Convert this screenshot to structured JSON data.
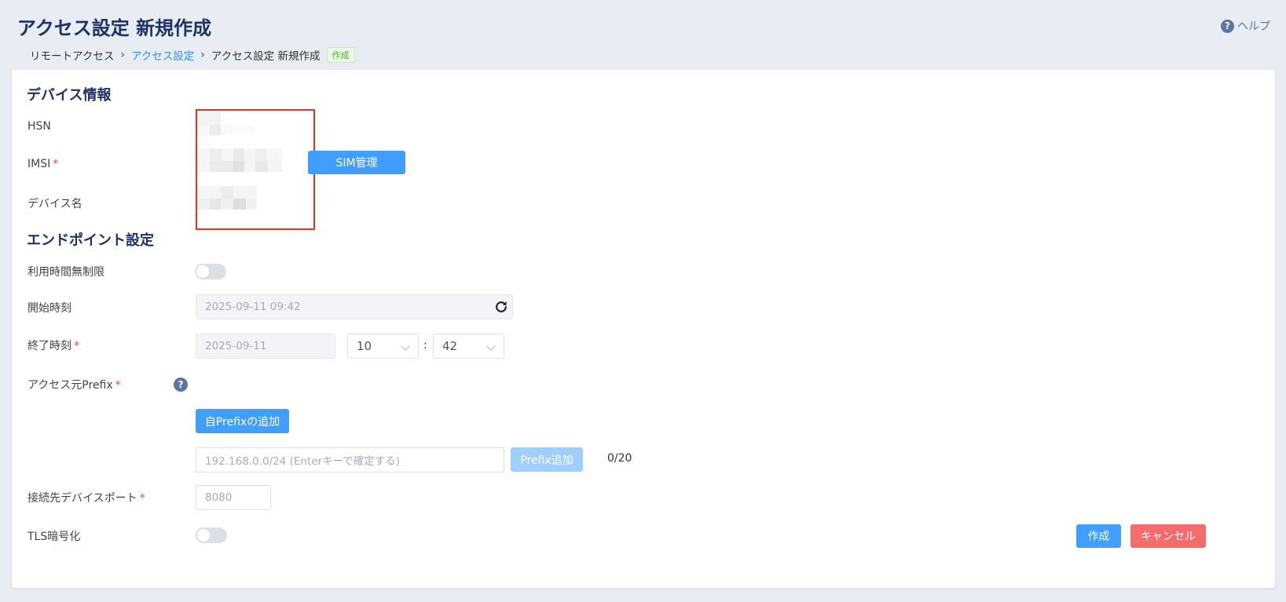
{
  "page": {
    "title": "アクセス設定 新規作成",
    "help_label": "ヘルプ"
  },
  "breadcrumb": {
    "items": [
      "リモートアクセス",
      "アクセス設定",
      "アクセス設定 新規作成"
    ],
    "badge": "作成"
  },
  "device_section": {
    "title": "デバイス情報",
    "hsn_label": "HSN",
    "imsi_label": "IMSI",
    "device_name_label": "デバイス名",
    "sim_button": "SIM管理"
  },
  "endpoint_section": {
    "title": "エンドポイント設定",
    "unlimited_label": "利用時間無制限",
    "start_label": "開始時刻",
    "start_value": "2025-09-11 09:42",
    "end_label": "終了時刻",
    "end_date": "2025-09-11",
    "end_hour": "10",
    "end_minute": "42",
    "time_sep": ":",
    "prefix_label": "アクセス元Prefix",
    "add_own_prefix_button": "自Prefixの追加",
    "prefix_placeholder": "192.168.0.0/24 (Enterキーで確定する)",
    "prefix_add_button": "Prefix追加",
    "prefix_counter": "0/20",
    "port_label": "接続先デバイスポート",
    "port_placeholder": "8080",
    "tls_label": "TLS暗号化"
  },
  "required_mark": "*",
  "actions": {
    "create": "作成",
    "cancel": "キャンセル"
  },
  "colors": {
    "title": "#1f3266",
    "primary": "#409eff",
    "danger": "#f56c6c",
    "highlight": "#e8341f"
  },
  "icons": {
    "help": "question-circle-icon",
    "breadcrumb_separator": "chevron-right-icon",
    "refresh": "refresh-icon",
    "select": "chevron-down-icon"
  }
}
